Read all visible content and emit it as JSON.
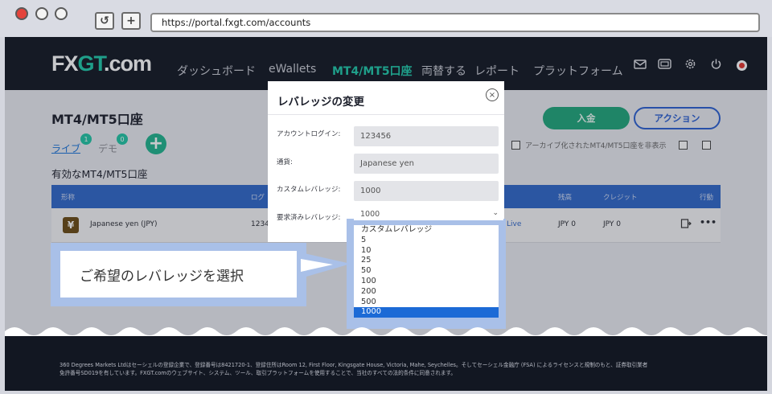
{
  "browser": {
    "url": "https://portal.fxgt.com/accounts",
    "refresh_glyph": "↺",
    "new_tab_glyph": "+"
  },
  "header": {
    "logo_fx": "FX",
    "logo_gt": "GT",
    "logo_suffix": ".com",
    "nav": [
      "ダッシュボード",
      "eWallets",
      "MT4/MT5口座",
      "両替する",
      "レポート",
      "プラットフォーム"
    ],
    "icons": [
      "mail-icon",
      "ticket-icon",
      "gear-icon",
      "power-icon",
      "record-icon"
    ]
  },
  "page": {
    "title": "MT4/MT5口座",
    "tab_live": "ライブ",
    "tab_live_count": "1",
    "tab_demo": "デモ",
    "tab_demo_count": "0",
    "add_glyph": "+",
    "section_title": "有効なMT4/MT5口座",
    "deposit_button": "入金",
    "action_button": "アクション",
    "archive_label": "アーカイブ化されたMT4/MT5口座を非表示"
  },
  "table": {
    "headers": [
      "形称",
      "ログ",
      "残高",
      "クレジット",
      "行動"
    ],
    "row": {
      "currency_glyph": "¥",
      "name": "Japanese yen (JPY)",
      "login": "1234",
      "server": "Live",
      "balance": "JPY 0",
      "credit": "JPY 0",
      "menu": "•••"
    }
  },
  "modal": {
    "title": "レバレッジの変更",
    "close_glyph": "×",
    "fields": [
      {
        "label": "アカウントログイン:",
        "value": "123456"
      },
      {
        "label": "通貨:",
        "value": "Japanese yen"
      },
      {
        "label": "カスタムレバレッジ:",
        "value": "1000"
      }
    ],
    "select_label": "要求済みレバレッジ:",
    "select_value": "1000",
    "select_caret": "⌄"
  },
  "dropdown": {
    "options": [
      "カスタムレバレッジ",
      "5",
      "10",
      "25",
      "50",
      "100",
      "200",
      "500",
      "1000"
    ],
    "selected_index": 8
  },
  "callout": {
    "text": "ご希望のレバレッジを選択"
  },
  "footer": {
    "line1": "360 Degrees Markets Ltdはセーシェルの登録企業で、登録番号は8421720-1、登録住所はRoom 12, First Floor, Kingsgate House, Victoria, Mahe, Seychelles。そしてセーシェル金融庁 (FSA) によるライセンスと規制のもと、証券取引業者",
    "line2": "免許番号SD019を有しています。FXGT.comのウェブサイト、システム、ツール、取引プラットフォームを使用することで、当社のすべての法的条件に同意されます。"
  },
  "colors": {
    "brand_green": "#1fc9a9",
    "header_bg": "#121722",
    "table_header": "#2f67c8",
    "selected_option": "#1c6ad6",
    "highlight_frame": "#a9c0e8"
  }
}
